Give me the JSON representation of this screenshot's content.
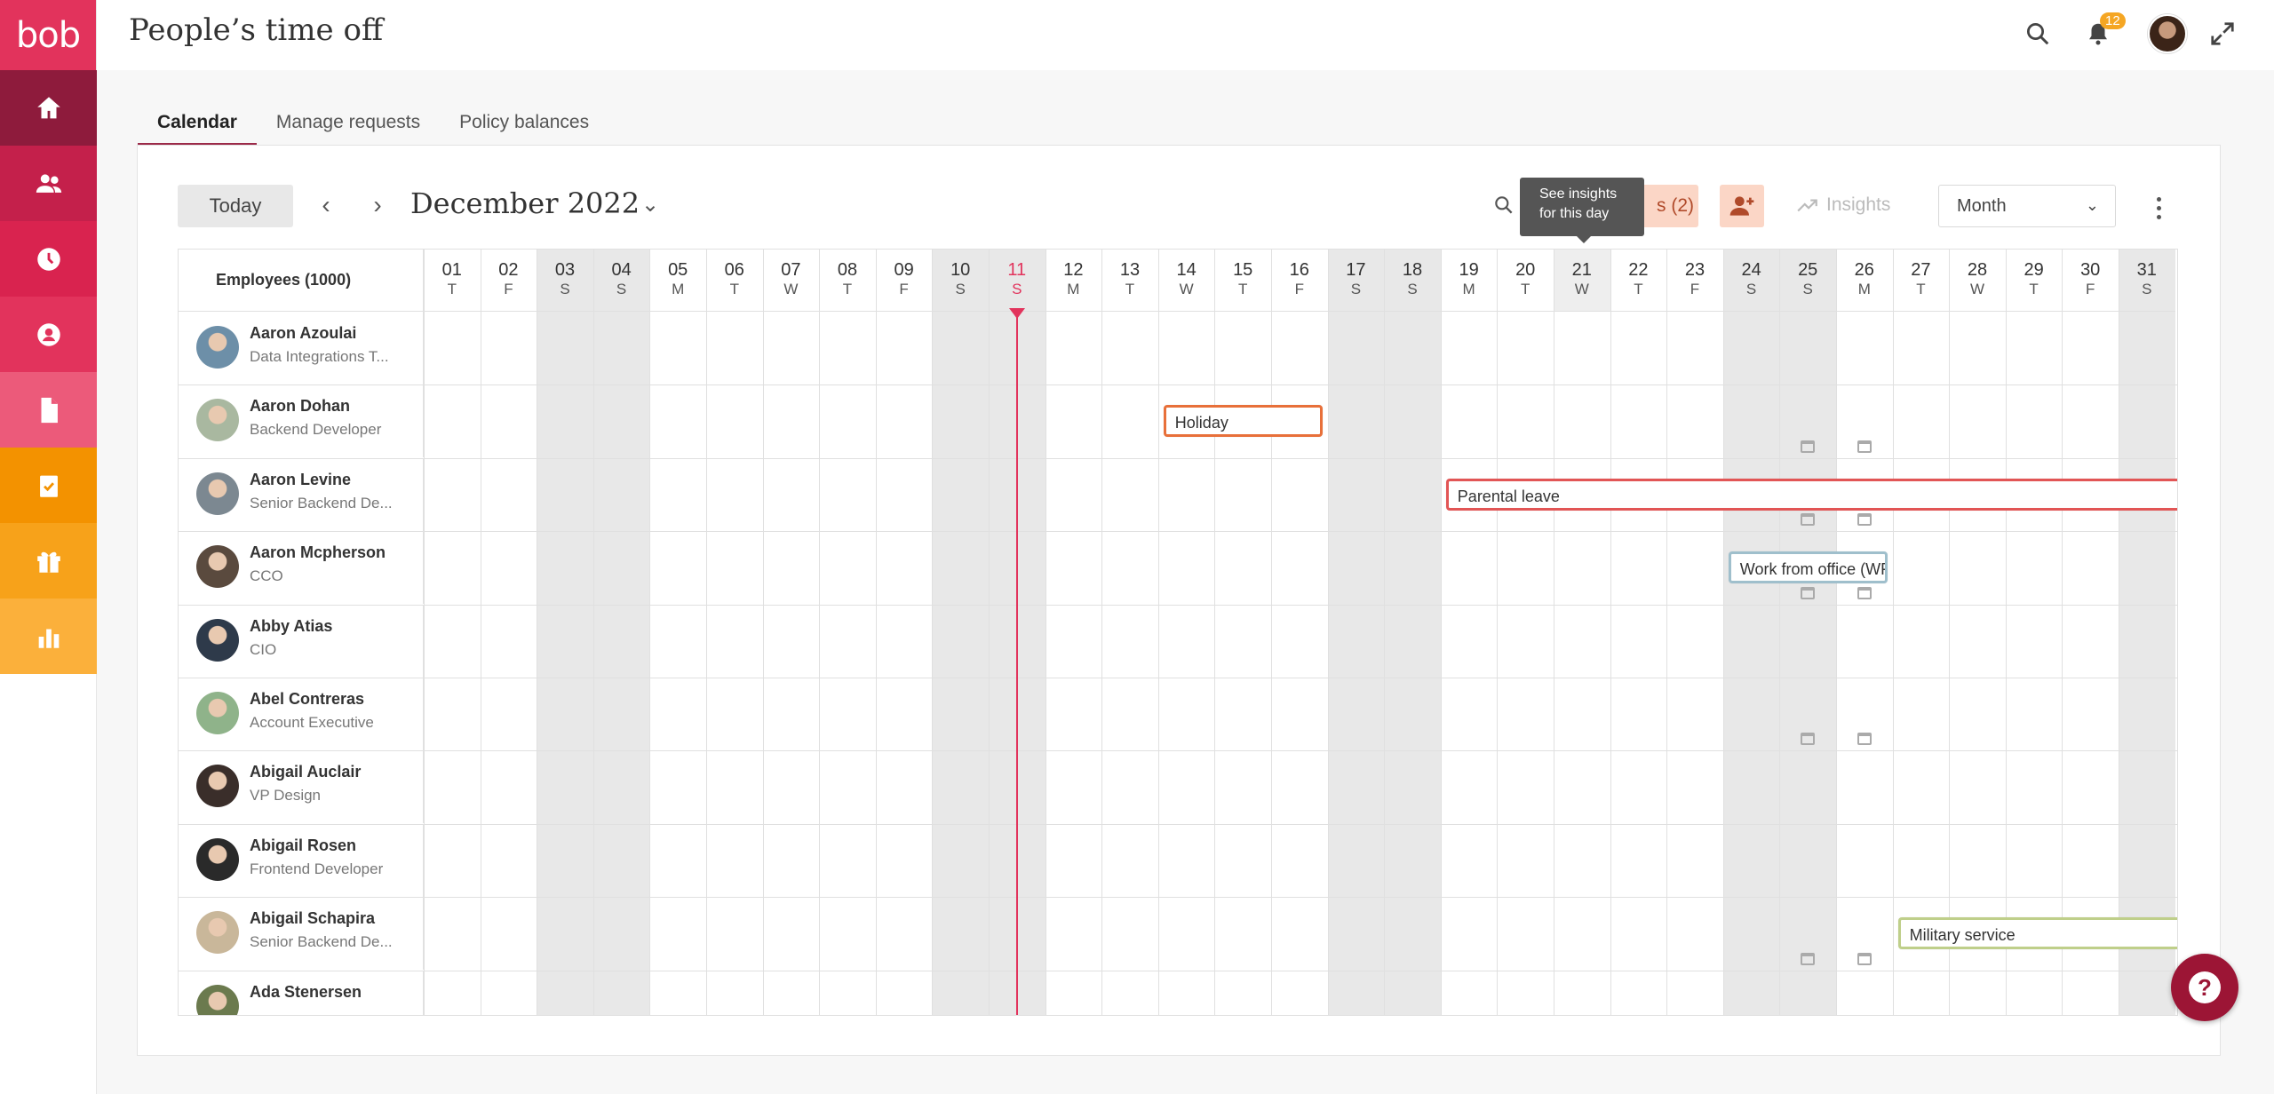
{
  "app": {
    "logo": "bob",
    "page_title": "People’s time off",
    "notifications_count": "12"
  },
  "colors": {
    "brand": "#e2335c",
    "accent": "#9c2a49",
    "today": "#e2335c",
    "weekend": "#e8e8e8"
  },
  "sidebar": {
    "items": [
      {
        "name": "home",
        "icon": "home-icon",
        "color": "#8e1b3c"
      },
      {
        "name": "people",
        "icon": "people-icon",
        "color": "#c4204b"
      },
      {
        "name": "time",
        "icon": "clock-icon",
        "color": "#d9234f"
      },
      {
        "name": "profile",
        "icon": "user-circle-icon",
        "color": "#e2335c"
      },
      {
        "name": "documents",
        "icon": "document-icon",
        "color": "#ec5a7a"
      },
      {
        "name": "tasks",
        "icon": "clipboard-check-icon",
        "color": "#f39200"
      },
      {
        "name": "perks",
        "icon": "gift-icon",
        "color": "#f7a21a"
      },
      {
        "name": "analytics",
        "icon": "bar-chart-icon",
        "color": "#fbb03b"
      }
    ]
  },
  "tabs": [
    {
      "label": "Calendar",
      "active": true
    },
    {
      "label": "Manage requests",
      "active": false
    },
    {
      "label": "Policy balances",
      "active": false
    }
  ],
  "toolbar": {
    "today_label": "Today",
    "month_label": "December 2022",
    "tooltip": [
      "See insights",
      "for this day"
    ],
    "filter_label": "s (2)",
    "insights_label": "Insights",
    "view_select": "Month"
  },
  "calendar": {
    "employees_header": "Employees (1000)",
    "today_index": 10,
    "highlight_index": 20,
    "weekend_indices": [
      2,
      3,
      9,
      10,
      16,
      17,
      23,
      24,
      30
    ],
    "days": [
      {
        "d": "01",
        "w": "T"
      },
      {
        "d": "02",
        "w": "F"
      },
      {
        "d": "03",
        "w": "S"
      },
      {
        "d": "04",
        "w": "S"
      },
      {
        "d": "05",
        "w": "M"
      },
      {
        "d": "06",
        "w": "T"
      },
      {
        "d": "07",
        "w": "W"
      },
      {
        "d": "08",
        "w": "T"
      },
      {
        "d": "09",
        "w": "F"
      },
      {
        "d": "10",
        "w": "S"
      },
      {
        "d": "11",
        "w": "S"
      },
      {
        "d": "12",
        "w": "M"
      },
      {
        "d": "13",
        "w": "T"
      },
      {
        "d": "14",
        "w": "W"
      },
      {
        "d": "15",
        "w": "T"
      },
      {
        "d": "16",
        "w": "F"
      },
      {
        "d": "17",
        "w": "S"
      },
      {
        "d": "18",
        "w": "S"
      },
      {
        "d": "19",
        "w": "M"
      },
      {
        "d": "20",
        "w": "T"
      },
      {
        "d": "21",
        "w": "W"
      },
      {
        "d": "22",
        "w": "T"
      },
      {
        "d": "23",
        "w": "F"
      },
      {
        "d": "24",
        "w": "S"
      },
      {
        "d": "25",
        "w": "S"
      },
      {
        "d": "26",
        "w": "M"
      },
      {
        "d": "27",
        "w": "T"
      },
      {
        "d": "28",
        "w": "W"
      },
      {
        "d": "29",
        "w": "T"
      },
      {
        "d": "30",
        "w": "F"
      },
      {
        "d": "31",
        "w": "S"
      }
    ],
    "employees": [
      {
        "name": "Aaron Azoulai",
        "title": "Data Integrations T...",
        "avatar": "#6d8fa8"
      },
      {
        "name": "Aaron Dohan",
        "title": "Backend Developer",
        "avatar": "#a9b8a0"
      },
      {
        "name": "Aaron Levine",
        "title": "Senior Backend De...",
        "avatar": "#7c8891"
      },
      {
        "name": "Aaron Mcpherson",
        "title": "CCO",
        "avatar": "#5a4a3e"
      },
      {
        "name": "Abby Atias",
        "title": "CIO",
        "avatar": "#2e3a4a"
      },
      {
        "name": "Abel Contreras",
        "title": "Account Executive",
        "avatar": "#8fb38a"
      },
      {
        "name": "Abigail Auclair",
        "title": "VP Design",
        "avatar": "#3a2e2a"
      },
      {
        "name": "Abigail Rosen",
        "title": "Frontend Developer",
        "avatar": "#2a2a2a"
      },
      {
        "name": "Abigail Schapira",
        "title": "Senior Backend De...",
        "avatar": "#c9b79a"
      },
      {
        "name": "Ada Stenersen",
        "title": "",
        "avatar": "#6b7a4e"
      }
    ],
    "events": [
      {
        "row": 1,
        "start": 13,
        "end": 16,
        "label": "Holiday",
        "color": "#e8703a"
      },
      {
        "row": 2,
        "start": 18,
        "end": 30,
        "label": "Parental leave",
        "color": "#e25555",
        "continues": true
      },
      {
        "row": 3,
        "start": 23,
        "end": 26,
        "label": "Work from office (WFO)",
        "color": "#9fbfcc"
      },
      {
        "row": 8,
        "start": 26,
        "end": 30,
        "label": "Military service",
        "color": "#bfcf8a",
        "continues": true
      }
    ],
    "cal_icons_rows": [
      1,
      2,
      3,
      5,
      8
    ],
    "cal_icons_cols": [
      24,
      25
    ]
  },
  "help_label": "?"
}
